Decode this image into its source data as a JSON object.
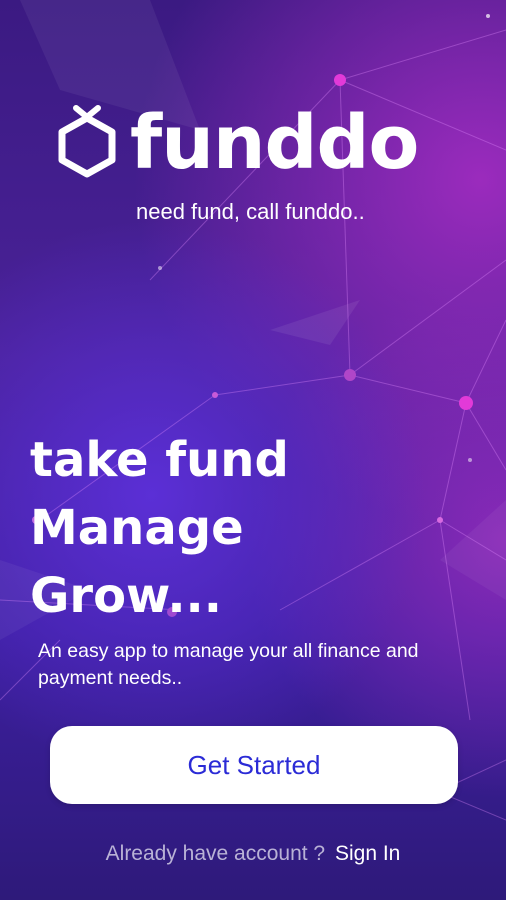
{
  "brand": {
    "name": "funddo",
    "tagline": "need fund, call funddo..",
    "logo_icon": "hexagon-logo-icon"
  },
  "hero": {
    "line1": "take fund",
    "line2": "Manage",
    "line3": "Grow...",
    "description": "An easy app to manage your all finance and payment needs.."
  },
  "actions": {
    "get_started_label": "Get Started",
    "signin_prompt": "Already have account ?",
    "signin_label": "Sign In"
  },
  "colors": {
    "button_text": "#2b2bd6",
    "node_pink": "#e23ad8",
    "background": "#3a1a8c"
  }
}
